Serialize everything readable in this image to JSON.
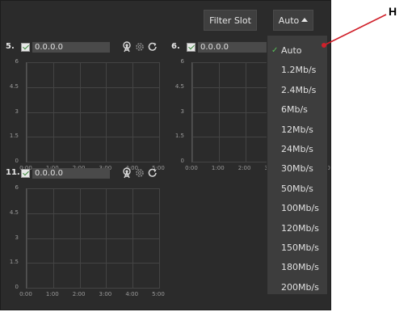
{
  "toolbar": {
    "filter_slot_label": "Filter Slot",
    "rate_label": "Auto"
  },
  "slots": [
    {
      "number": "5.",
      "ip": "0.0.0.0"
    },
    {
      "number": "6.",
      "ip": "0.0.0.0"
    },
    {
      "number": "11.",
      "ip": "0.0.0.0"
    }
  ],
  "chart_data": {
    "type": "line",
    "y_ticks": [
      "6",
      "4.5",
      "3",
      "1.5",
      "0"
    ],
    "x_ticks": [
      "0:00",
      "1:00",
      "2:00",
      "3:00",
      "4:00",
      "5:00"
    ],
    "ylim": [
      0,
      6
    ],
    "grid": true,
    "series": []
  },
  "rate_menu": {
    "selected": "Auto",
    "options": [
      "Auto",
      "1.2Mb/s",
      "2.4Mb/s",
      "6Mb/s",
      "12Mb/s",
      "24Mb/s",
      "30Mb/s",
      "50Mb/s",
      "100Mb/s",
      "120Mb/s",
      "150Mb/s",
      "180Mb/s",
      "200Mb/s"
    ]
  },
  "callout": {
    "label": "H",
    "color": "#d0202a"
  },
  "colors": {
    "panel_bg": "#2b2b2b",
    "menu_bg": "#3d3d3d",
    "check_green": "#59c159"
  },
  "icons": [
    "antenna-icon",
    "gear-icon",
    "refresh-icon",
    "checkmark-icon",
    "caret-up-icon"
  ]
}
